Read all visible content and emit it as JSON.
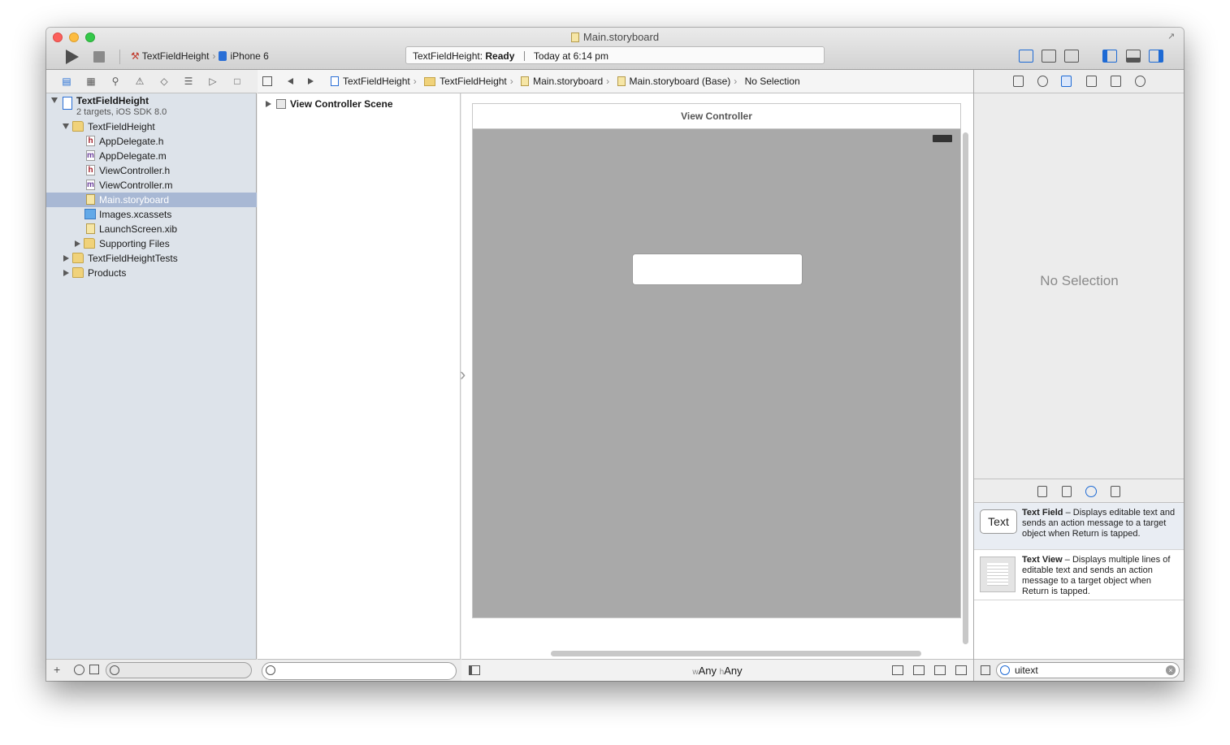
{
  "window": {
    "title": "Main.storyboard"
  },
  "toolbar": {
    "scheme_name": "TextFieldHeight",
    "device_name": "iPhone 6",
    "activity_project": "TextFieldHeight:",
    "activity_status": "Ready",
    "activity_time": "Today at 6:14 pm"
  },
  "navigator": {
    "tabs": [
      "project-navigator",
      "symbol-navigator",
      "find-navigator",
      "issue-navigator",
      "test-navigator",
      "debug-navigator",
      "breakpoint-navigator",
      "report-navigator"
    ],
    "project": {
      "name": "TextFieldHeight",
      "subtitle": "2 targets, iOS SDK 8.0"
    },
    "items": [
      {
        "label": "TextFieldHeight",
        "kind": "folder",
        "depth": 1,
        "expanded": true
      },
      {
        "label": "AppDelegate.h",
        "kind": "h",
        "depth": 2
      },
      {
        "label": "AppDelegate.m",
        "kind": "m",
        "depth": 2
      },
      {
        "label": "ViewController.h",
        "kind": "h",
        "depth": 2
      },
      {
        "label": "ViewController.m",
        "kind": "m",
        "depth": 2
      },
      {
        "label": "Main.storyboard",
        "kind": "storyboard",
        "depth": 2,
        "selected": true
      },
      {
        "label": "Images.xcassets",
        "kind": "xcassets",
        "depth": 2
      },
      {
        "label": "LaunchScreen.xib",
        "kind": "xib",
        "depth": 2
      },
      {
        "label": "Supporting Files",
        "kind": "folder",
        "depth": 2,
        "expanded": false
      },
      {
        "label": "TextFieldHeightTests",
        "kind": "folder",
        "depth": 1,
        "expanded": false
      },
      {
        "label": "Products",
        "kind": "folder",
        "depth": 1,
        "expanded": false
      }
    ]
  },
  "jumpbar": {
    "crumbs": [
      "TextFieldHeight",
      "TextFieldHeight",
      "Main.storyboard",
      "Main.storyboard (Base)",
      "No Selection"
    ]
  },
  "outline": {
    "scene": "View Controller Scene"
  },
  "canvas": {
    "view_controller_title": "View Controller",
    "size_class_w_prefix": "w",
    "size_class_w": "Any",
    "size_class_h_prefix": "h",
    "size_class_h": "Any"
  },
  "inspector": {
    "empty_text": "No Selection"
  },
  "library": {
    "items": [
      {
        "title": "Text Field",
        "description": " – Displays editable text and sends an action message to a target object when Return is tapped.",
        "thumb_text": "Text"
      },
      {
        "title": "Text View",
        "description": " – Displays multiple lines of editable text and sends an action message to a target object when Return is tapped."
      }
    ],
    "filter_value": "uitext"
  },
  "colors": {
    "selection": "#a8b8d4",
    "accent": "#1e6ad4",
    "canvas_view": "#a9a9a9"
  }
}
